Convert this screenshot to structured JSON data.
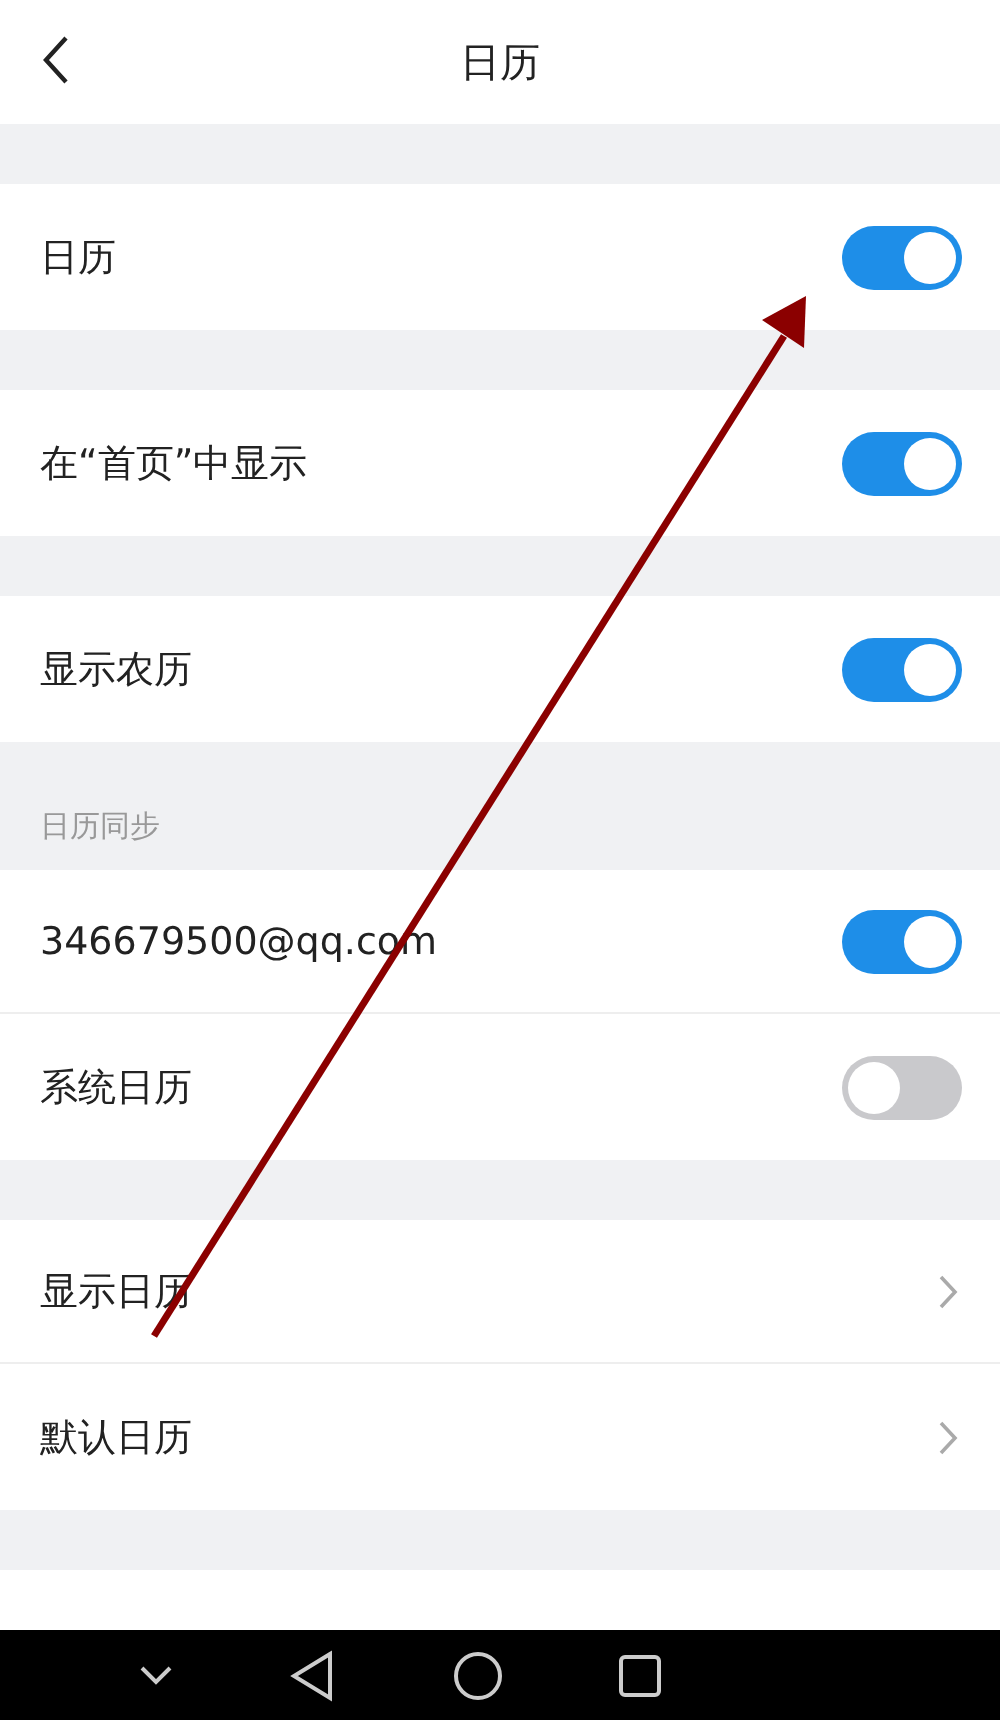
{
  "header": {
    "title": "日历"
  },
  "sections": [
    {
      "items": [
        {
          "kind": "toggle",
          "label": "日历",
          "on": true
        }
      ]
    },
    {
      "items": [
        {
          "kind": "toggle",
          "label": "在“首页”中显示",
          "on": true
        }
      ]
    },
    {
      "items": [
        {
          "kind": "toggle",
          "label": "显示农历",
          "on": true
        }
      ]
    },
    {
      "title": "日历同步",
      "items": [
        {
          "kind": "toggle",
          "label": "346679500@qq.com",
          "on": true
        },
        {
          "kind": "toggle",
          "label": "系统日历",
          "on": false
        }
      ]
    },
    {
      "items": [
        {
          "kind": "link",
          "label": "显示日历"
        },
        {
          "kind": "link",
          "label": "默认日历"
        }
      ]
    }
  ]
}
